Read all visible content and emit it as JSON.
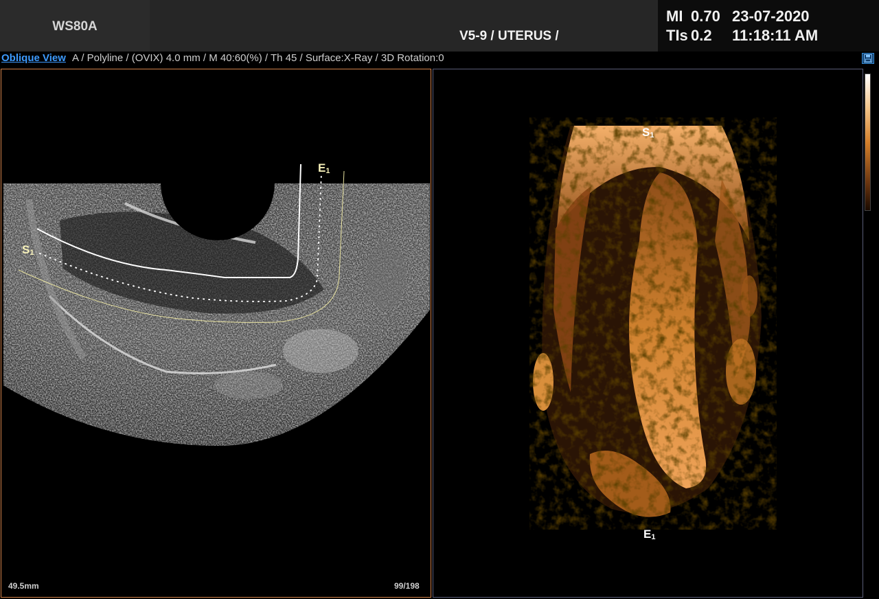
{
  "header": {
    "brand": "WS80A",
    "probe_preset": "V5-9 / UTERUS /",
    "mi_label": "MI",
    "mi_value": "0.70",
    "tis_label": "TIs",
    "tis_value": "0.2",
    "date": "23-07-2020",
    "time": "11:18:11 AM"
  },
  "status_bar": {
    "view_link": "Oblique View",
    "settings": "A / Polyline / (OVIX) 4.0 mm / M 40:60(%) / Th 45 / Surface:X-Ray / 3D Rotation:0"
  },
  "left_pane": {
    "start_marker": "S",
    "start_sub": "1",
    "end_marker": "E",
    "end_sub": "1",
    "depth": "49.5mm",
    "frame": "99/198"
  },
  "right_pane": {
    "start_marker": "S",
    "start_sub": "1",
    "end_marker": "E",
    "end_sub": "1"
  },
  "icons": {
    "save": "save-icon",
    "colorbar": "color-scale-bar"
  },
  "colors": {
    "link": "#3d9bff",
    "left_border": "#d4824a",
    "right_border": "#5a5d78",
    "render_tint": "#d4862f",
    "marker_yellow": "#f6f0b8"
  }
}
